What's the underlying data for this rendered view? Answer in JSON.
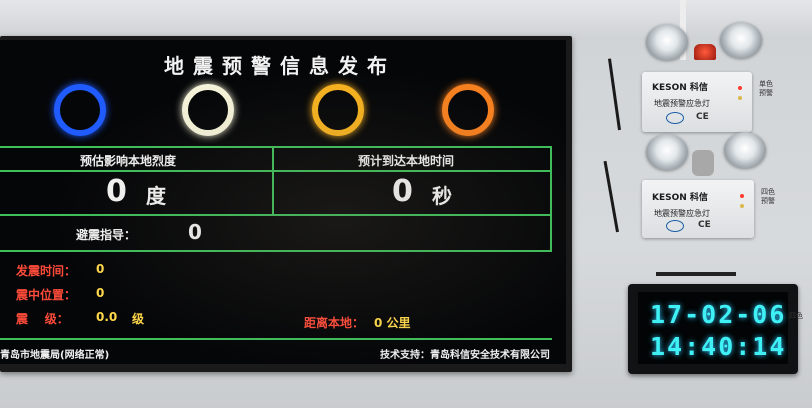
{
  "screen": {
    "title": "地震预警信息发布",
    "alert_ring_colors": [
      "#1f5bff",
      "#f4f2d8",
      "#f7b21f",
      "#f7801f"
    ],
    "intensity": {
      "label": "预估影响本地烈度",
      "value": "0",
      "unit": "度"
    },
    "arrival": {
      "label": "预计到达本地时间",
      "value": "0",
      "unit": "秒"
    },
    "guide": {
      "label": "避震指导：",
      "value": "0"
    },
    "details": {
      "time_label": "发震时间：",
      "time_value": "0",
      "location_label": "震中位置：",
      "location_value": "0",
      "magnitude_label": "震    级：",
      "magnitude_value": "0.0",
      "magnitude_unit": "级",
      "distance_label": "距离本地：",
      "distance_value": "0 公里"
    },
    "footer": {
      "left": "青岛市地震局(网络正常)",
      "right": "技术支持：青岛科信安全技术有限公司"
    }
  },
  "devices": [
    {
      "brand": "KESON 科信",
      "name": "地震预警应急灯",
      "side_tag": "单色预警"
    },
    {
      "brand": "KESON 科信",
      "name": "地震预警应急灯",
      "side_tag": "四色预警"
    }
  ],
  "clock": {
    "date": "17-02-06",
    "time": "14:40:14",
    "side_tag": "四色"
  }
}
